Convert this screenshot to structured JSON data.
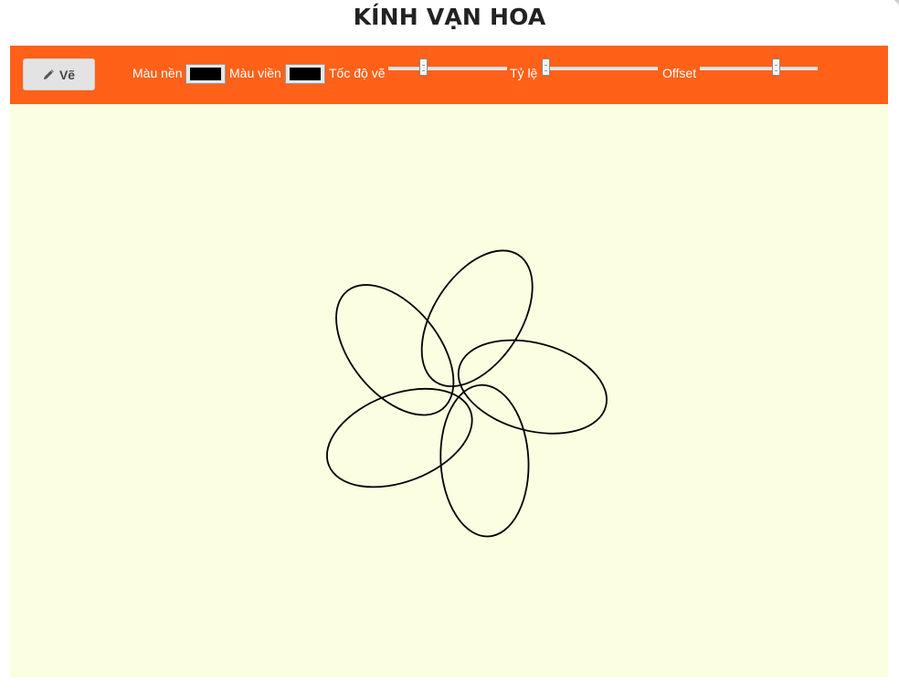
{
  "page": {
    "title": "KÍNH VẠN HOA"
  },
  "toolbar": {
    "draw_button": {
      "label": "Vẽ",
      "icon": "pencil-icon"
    },
    "background_color": {
      "label": "Màu nền",
      "value": "#000000"
    },
    "border_color": {
      "label": "Màu viền",
      "value": "#000000"
    },
    "speed": {
      "label": "Tốc độ vẽ",
      "value_fraction": 0.3
    },
    "ratio": {
      "label": "Tỷ lệ",
      "value_fraction": 0.04
    },
    "offset": {
      "label": "Offset",
      "value_fraction": 0.65
    }
  },
  "canvas": {
    "background": "#fbfee1",
    "stroke": "#000000",
    "petal_count": 5
  },
  "colors": {
    "toolbar_bg": "#ff6119",
    "button_bg": "#e3e3e3",
    "title_text": "#222222"
  }
}
